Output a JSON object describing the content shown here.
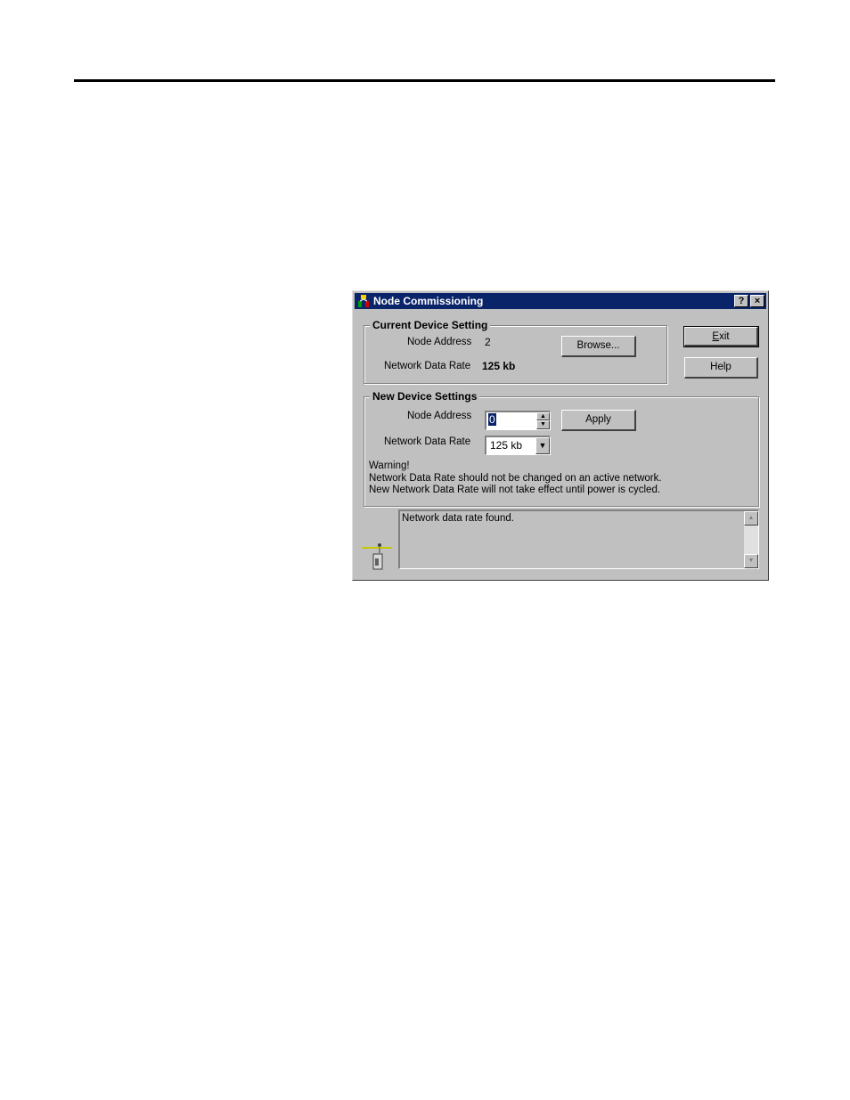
{
  "window": {
    "title": "Node Commissioning",
    "help_button": "?",
    "close_button": "×"
  },
  "current": {
    "group_title": "Current Device Setting",
    "node_address_label": "Node Address",
    "node_address_value": "2",
    "data_rate_label": "Network Data Rate",
    "data_rate_value": "125 kb",
    "browse_button": "Browse..."
  },
  "buttons": {
    "exit_mnemonic": "E",
    "exit_rest": "xit",
    "help": "Help"
  },
  "new_settings": {
    "group_title": "New Device Settings",
    "node_address_label": "Node Address",
    "node_address_value": "0",
    "data_rate_label": "Network Data Rate",
    "data_rate_value": "125 kb",
    "apply_button": "Apply",
    "warning_title": "Warning!",
    "warning_line1": "Network Data Rate should not be changed on an active network.",
    "warning_line2": "New Network Data Rate will not take effect until power is cycled."
  },
  "status": {
    "message": "Network data rate found."
  },
  "icons": {
    "app": "node-commissioning-app-icon",
    "network": "network-node-icon",
    "spin_up": "▲",
    "spin_down": "▼",
    "dropdown": "▼",
    "scroll_up": "▲",
    "scroll_down": "▼"
  },
  "colors": {
    "titlebar": "#0a246a",
    "dialog_face": "#c0c0c0"
  }
}
